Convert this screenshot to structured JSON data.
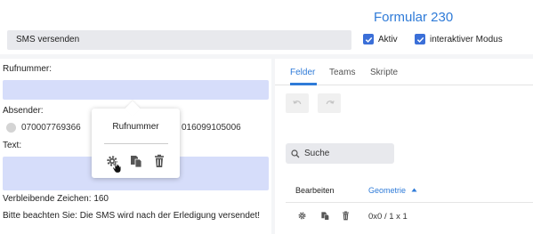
{
  "header": {
    "form_title": "Formular 230",
    "name_value": "SMS versenden",
    "checkbox_aktiv": {
      "label": "Aktiv",
      "checked": true
    },
    "checkbox_interaktiv": {
      "label": "interaktiver Modus",
      "checked": true
    }
  },
  "left": {
    "rufnummer_label": "Rufnummer:",
    "rufnummer_value": "",
    "absender_label": "Absender:",
    "absender_options": [
      "070007769366",
      "016099105006"
    ],
    "text_label": "Text:",
    "text_value": "",
    "remaining_label": "Verbleibende Zeichen:",
    "remaining_count": "160",
    "notice": "Bitte beachten Sie: Die SMS wird nach der Erledigung versendet!"
  },
  "popup": {
    "title": "Rufnummer",
    "icons": [
      "gear-icon",
      "copy-icon",
      "trash-icon"
    ]
  },
  "right": {
    "tabs": [
      {
        "label": "Felder",
        "active": true
      },
      {
        "label": "Teams",
        "active": false
      },
      {
        "label": "Skripte",
        "active": false
      }
    ],
    "toolbar": {
      "undo_icon": "undo-icon",
      "redo_icon": "redo-icon"
    },
    "search_placeholder": "Suche",
    "table": {
      "columns": [
        "Bearbeiten",
        "Geometrie"
      ],
      "sort_column": "Geometrie",
      "sort_direction": "ascending",
      "rows": [
        {
          "icons": [
            "gear-icon",
            "copy-icon",
            "trash-icon"
          ],
          "geometrie": "0x0 / 1 x 1"
        }
      ]
    }
  },
  "colors": {
    "accent": "#2f7bd8",
    "checkbox": "#3b6fd8",
    "input_highlight": "#d6ddfa",
    "field_bg": "#e8e9ed"
  }
}
